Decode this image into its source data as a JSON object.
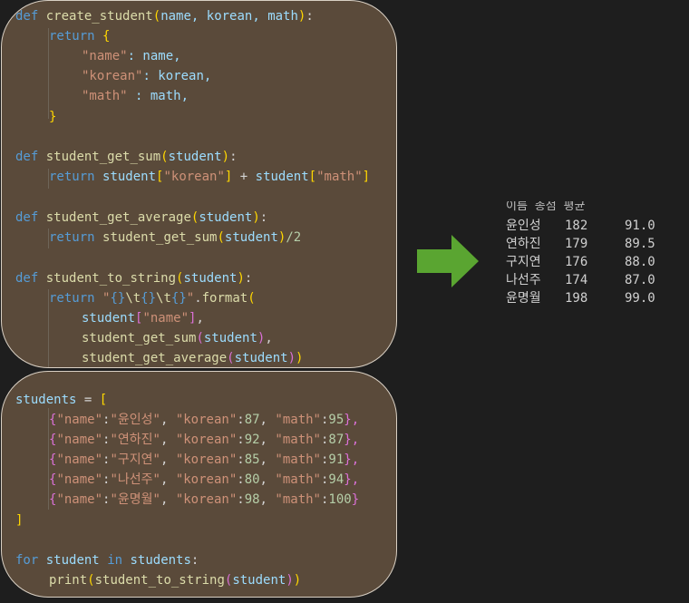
{
  "code_top": {
    "l1": {
      "def": "def",
      "fn": "create_student",
      "p1": "(",
      "args": "name, korean, math",
      "p2": ")",
      "colon": ":"
    },
    "l2": {
      "ret": "return",
      "brace": "{"
    },
    "l3": {
      "key": "\"name\"",
      "rest": ": name,"
    },
    "l4": {
      "key": "\"korean\"",
      "rest": ": korean,"
    },
    "l5": {
      "key": "\"math\"",
      "rest": " : math,"
    },
    "l6": {
      "brace": "}"
    },
    "l8": {
      "def": "def",
      "fn": "student_get_sum",
      "p1": "(",
      "args": "student",
      "p2": ")",
      "colon": ":"
    },
    "l9": {
      "ret": "return",
      "a": "student",
      "b1": "[",
      "k1": "\"korean\"",
      "b2": "]",
      "plus": " + ",
      "c": "student",
      "b3": "[",
      "k2": "\"math\"",
      "b4": "]"
    },
    "l11": {
      "def": "def",
      "fn": "student_get_average",
      "p1": "(",
      "args": "student",
      "p2": ")",
      "colon": ":"
    },
    "l12": {
      "ret": "return",
      "fn": "student_get_sum",
      "p1": "(",
      "arg": "student",
      "p2": ")",
      "tail": "/2"
    },
    "l14": {
      "def": "def",
      "fn": "student_to_string",
      "p1": "(",
      "args": "student",
      "p2": ")",
      "colon": ":"
    },
    "l15": {
      "ret": "return",
      "s1": "\"",
      "b1": "{}",
      "e1": "\\t",
      "b2": "{}",
      "e2": "\\t",
      "b3": "{}",
      "s2": "\"",
      "dot": ".",
      "fn": "format",
      "p1": "("
    },
    "l16": {
      "a": "student",
      "b1": "[",
      "k": "\"name\"",
      "b2": "]",
      "comma": ","
    },
    "l17": {
      "fn": "student_get_sum",
      "p1": "(",
      "arg": "student",
      "p2": ")",
      "comma": ","
    },
    "l18": {
      "fn": "student_get_average",
      "p1": "(",
      "arg": "student",
      "p2": ")",
      "p3": ")"
    }
  },
  "code_bottom": {
    "l1": {
      "var": "students",
      "eq": " = ",
      "br": "["
    },
    "rows": [
      {
        "name": "\"윤인성\"",
        "korean": "87",
        "math": "95",
        "end": "},"
      },
      {
        "name": "\"연하진\"",
        "korean": "92",
        "math": "87",
        "end": "},"
      },
      {
        "name": "\"구지연\"",
        "korean": "85",
        "math": "91",
        "end": "},"
      },
      {
        "name": "\"나선주\"",
        "korean": "80",
        "math": "94",
        "end": "},"
      },
      {
        "name": "\"윤명월\"",
        "korean": "98",
        "math": "100",
        "end": "}"
      }
    ],
    "keys": {
      "name": "\"name\"",
      "korean": "\"korean\"",
      "math": "\"math\""
    },
    "l7": {
      "br": "]"
    },
    "l9": {
      "for": "for",
      "var": "student",
      "in": "in",
      "list": "students",
      "colon": ":"
    },
    "l10": {
      "fn": "print",
      "p1": "(",
      "fn2": "student_to_string",
      "p2": "(",
      "arg": "student",
      "p3": ")",
      "p4": ")"
    }
  },
  "arrow": {
    "color": "#5aa531",
    "icon": "right-arrow-icon"
  },
  "output": {
    "clipped_header": "이름      총점     평균",
    "rows": [
      {
        "name": "윤인성",
        "sum": "182",
        "avg": "91.0"
      },
      {
        "name": "연하진",
        "sum": "179",
        "avg": "89.5"
      },
      {
        "name": "구지연",
        "sum": "176",
        "avg": "88.0"
      },
      {
        "name": "나선주",
        "sum": "174",
        "avg": "87.0"
      },
      {
        "name": "윤명월",
        "sum": "198",
        "avg": "99.0"
      }
    ]
  }
}
